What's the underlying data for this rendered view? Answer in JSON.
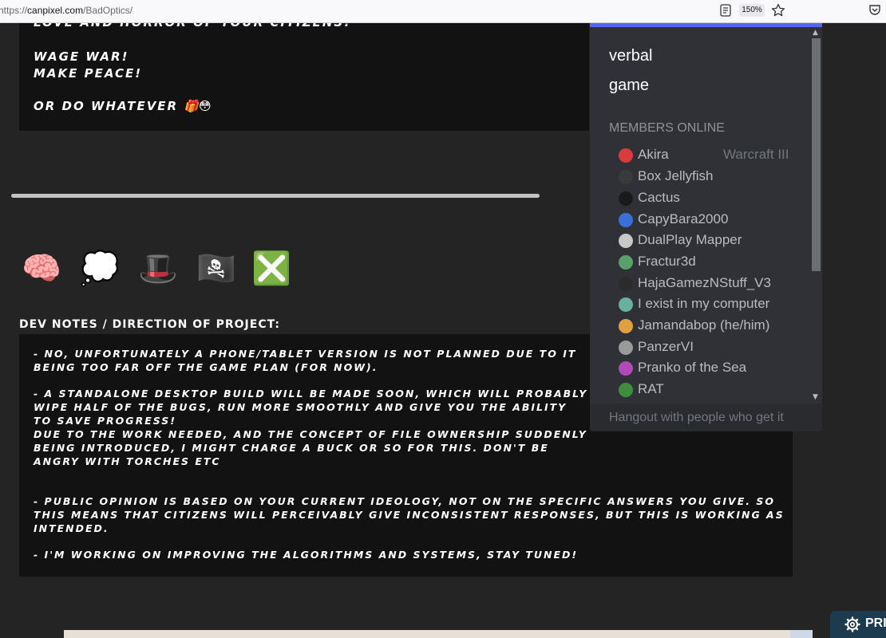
{
  "browser": {
    "url_prefix": "https://",
    "url_host": "canpixel.com",
    "url_path": "/BadOptics/",
    "zoom": "150%"
  },
  "description": {
    "lines": [
      "LOVE AND HORROR OF YOUR CITIZENS!",
      "WAGE WAR!",
      "MAKE PEACE!",
      "OR DO WHATEVER"
    ],
    "emoji_suffix": "🎁😳"
  },
  "emoji_row": [
    "🧠",
    "💭",
    "🎩",
    "🏴‍☠️",
    "❎"
  ],
  "dev_notes": {
    "title": "DEV NOTES / DIRECTION OF PROJECT:",
    "lines": [
      "- NO, UNFORTUNATELY A PHONE/TABLET VERSION IS NOT PLANNED DUE TO IT",
      "BEING TOO FAR OFF THE GAME PLAN (FOR NOW).",
      "- A STANDALONE DESKTOP BUILD WILL BE MADE SOON, WHICH WILL PROBABLY",
      "WIPE HALF OF THE BUGS, RUN MORE SMOOTHLY AND GIVE YOU THE ABILITY",
      "TO SAVE PROGRESS!",
      "DUE TO THE WORK NEEDED, AND THE CONCEPT OF FILE OWNERSHIP SUDDENLY",
      "BEING INTRODUCED, I MIGHT CHARGE A BUCK OR SO FOR THIS. DON'T BE",
      "ANGRY WITH TORCHES ETC",
      "- PUBLIC OPINION IS BASED ON YOUR CURRENT IDEOLOGY, NOT ON THE SPECIFIC ANSWERS YOU GIVE. SO",
      "THIS MEANS THAT CITIZENS WILL PERCEIVABLY GIVE INCONSISTENT RESPONSES, BUT THIS IS WORKING AS",
      "INTENDED.",
      "- I'M WORKING ON IMPROVING THE ALGORITHMS AND SYSTEMS, STAY TUNED!"
    ]
  },
  "widget": {
    "channels": [
      "verbal",
      "game"
    ],
    "members_heading": "MEMBERS ONLINE",
    "members": [
      {
        "name": "Akira",
        "game": "Warcraft III",
        "color": "#d83c3e"
      },
      {
        "name": "Box Jellyfish",
        "game": "",
        "color": "#3a3a3a"
      },
      {
        "name": "Cactus",
        "game": "",
        "color": "#1a1a1a"
      },
      {
        "name": "CapyBara2000",
        "game": "",
        "color": "#3b6fd8"
      },
      {
        "name": "DualPlay Mapper",
        "game": "",
        "color": "#c8c8c8"
      },
      {
        "name": "Fractur3d",
        "game": "",
        "color": "#5aa06a"
      },
      {
        "name": "HajaGamezNStuff_V3",
        "game": "",
        "color": "#2b2b2b"
      },
      {
        "name": "I exist in my computer",
        "game": "",
        "color": "#6ab0a0"
      },
      {
        "name": "Jamandabop (he/him)",
        "game": "",
        "color": "#e0a040"
      },
      {
        "name": "PanzerVI",
        "game": "",
        "color": "#9a9a9a"
      },
      {
        "name": "Pranko of the Sea",
        "game": "",
        "color": "#b04ab8"
      },
      {
        "name": "RAT",
        "game": "",
        "color": "#3e8e3e"
      }
    ],
    "footer": "Hangout with people who get it",
    "accent": "#5865f2"
  },
  "privacy_button": {
    "label": "PRI"
  }
}
